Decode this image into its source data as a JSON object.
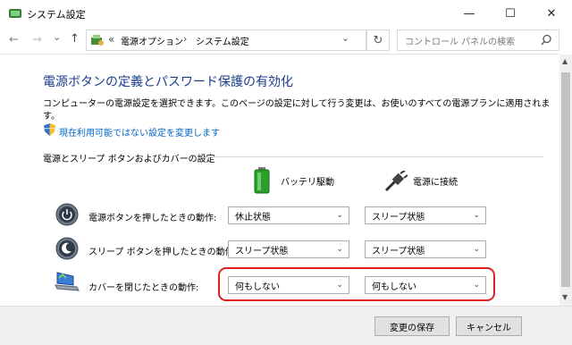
{
  "window": {
    "title": "システム設定",
    "minimize": "—",
    "maximize": "☐",
    "close": "✕"
  },
  "nav": {
    "back": "←",
    "forward": "→",
    "recent": "⌄",
    "up": "↑",
    "breadcrumb_sep": "«",
    "crumbs": [
      "電源オプション",
      "システム設定"
    ],
    "crumb_arrow": "›",
    "refresh": "↻",
    "search_placeholder": "コントロール パネルの検索",
    "address_dropdown": "⌄"
  },
  "page": {
    "heading": "電源ボタンの定義とパスワード保護の有効化",
    "desc_line1": "コンピューターの電源設定を選択できます。このページの設定に対して行う変更は、お使いのすべての電源プランに適用されま",
    "desc_line2": "す。",
    "change_link": "現在利用可能ではない設定を変更します",
    "section_title": "電源とスリープ ボタンおよびカバーの設定",
    "col_battery": "バッテリ駆動",
    "col_plugged": "電源に接続"
  },
  "rows": [
    {
      "label": "電源ボタンを押したときの動作:",
      "battery": "休止状態",
      "plugged": "スリープ状態"
    },
    {
      "label": "スリープ ボタンを押したときの動作:",
      "battery": "スリープ状態",
      "plugged": "スリープ状態"
    },
    {
      "label": "カバーを閉じたときの動作:",
      "battery": "何もしない",
      "plugged": "何もしない"
    }
  ],
  "footer": {
    "save": "変更の保存",
    "cancel": "キャンセル"
  },
  "colors": {
    "heading": "#1a3d8f",
    "link": "#0066cc",
    "highlight": "#e02020"
  }
}
